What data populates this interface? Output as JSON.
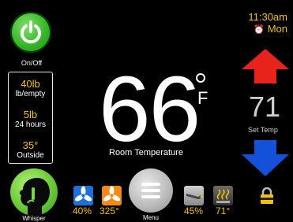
{
  "power": {
    "label": "On/Off"
  },
  "status": {
    "items": [
      {
        "value": "40lb",
        "label": "lb/empty"
      },
      {
        "value": "5lb",
        "label": "24 hours"
      },
      {
        "value": "35°",
        "label": "Outside"
      }
    ]
  },
  "whisper": {
    "label": "Whisper"
  },
  "room": {
    "temperature": "66",
    "unit": "F",
    "label": "Room Temperature"
  },
  "clock": {
    "time": "11:30am",
    "day": "Mon"
  },
  "setpoint": {
    "value": "71",
    "label": "Set Temp"
  },
  "toolbar": {
    "fan1_value": "40%",
    "fan2_value": "325°",
    "menu_label": "Menu",
    "flame_value": "45%",
    "heater_value": "71°"
  },
  "icons": {
    "power": "power-icon",
    "whisper": "whisper-icon",
    "up": "arrow-up-icon",
    "down": "arrow-down-icon",
    "lock": "lock-icon",
    "fan": "fan-icon",
    "menu": "hamburger-icon",
    "flame": "igniter-icon",
    "heater": "heater-icon",
    "clock": "alarm-clock-icon"
  },
  "colors": {
    "accent": "#f5c200",
    "power": "#35b526",
    "up_arrow": "#e8231c",
    "down_arrow": "#1451d8",
    "fan1": "#1d6fdc",
    "fan2": "#f28a18"
  }
}
